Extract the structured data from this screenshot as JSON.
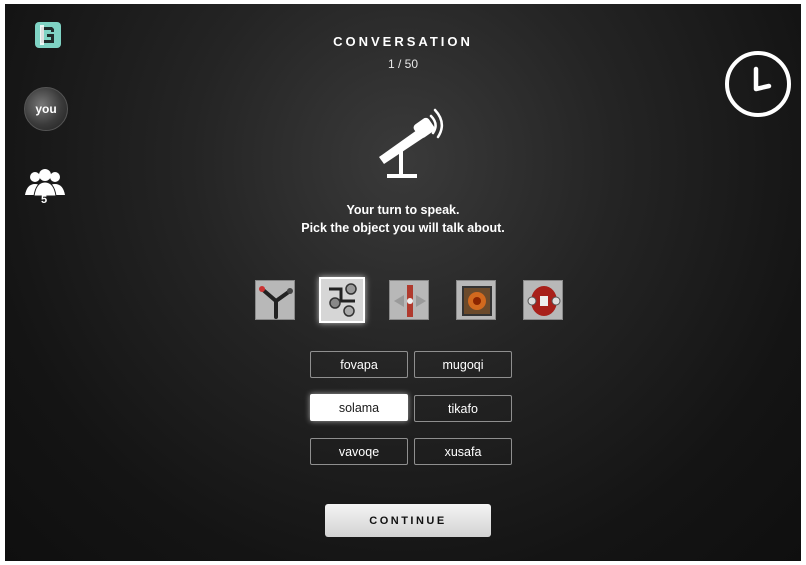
{
  "header": {
    "title": "CONVERSATION",
    "counter": "1 / 50"
  },
  "sidebar": {
    "logo_icon": "app-logo-icon",
    "avatar_label": "you",
    "group_icon": "group-icon",
    "group_count": "5"
  },
  "timer_icon": "clock-icon",
  "mic_icon": "microphone-icon",
  "prompt": {
    "line1": "Your turn to speak.",
    "line2": "Pick the object you will talk about."
  },
  "objects": [
    {
      "name": "object-1",
      "selected": false
    },
    {
      "name": "object-2",
      "selected": true
    },
    {
      "name": "object-3",
      "selected": false
    },
    {
      "name": "object-4",
      "selected": false
    },
    {
      "name": "object-5",
      "selected": false
    }
  ],
  "words": [
    {
      "label": "fovapa",
      "selected": false
    },
    {
      "label": "mugoqi",
      "selected": false
    },
    {
      "label": "solama",
      "selected": true
    },
    {
      "label": "tikafo",
      "selected": false
    },
    {
      "label": "vavoqe",
      "selected": false
    },
    {
      "label": "xusafa",
      "selected": false
    }
  ],
  "continue_label": "CONTINUE",
  "colors": {
    "background": "#1a1a1a",
    "logo": "#7fd3c4",
    "text": "#ffffff"
  }
}
